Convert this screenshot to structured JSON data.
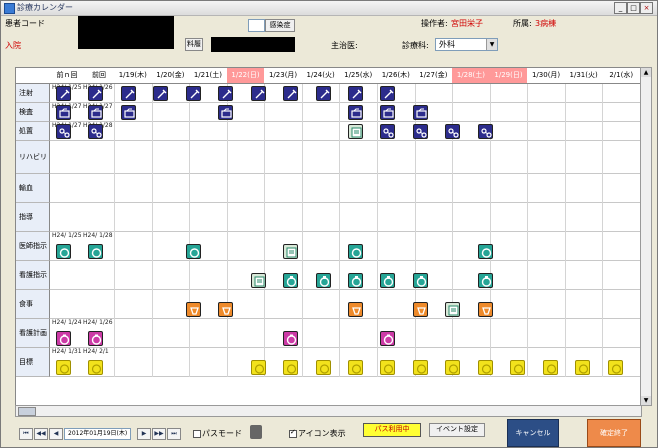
{
  "window": {
    "title": "診療カレンダー",
    "controls": [
      "_",
      "□",
      "×"
    ]
  },
  "header": {
    "patient_code_label": "患者コード",
    "inpatient_label": "入院",
    "small_button": "料履",
    "infection_button": "感染症",
    "operator_label": "操作者:",
    "operator_name": "宮田栄子",
    "affiliation_label": "所属:",
    "affiliation_value": "3病棟",
    "attending_label": "主治医:",
    "department_label": "診療科:",
    "department_value": "外科"
  },
  "calendar": {
    "nav": {
      "prev_n": "前ｎ回",
      "prev": "前回"
    },
    "days": [
      {
        "label": "1/19(木)",
        "holiday": false
      },
      {
        "label": "1/20(金)",
        "holiday": false
      },
      {
        "label": "1/21(土)",
        "holiday": false
      },
      {
        "label": "1/22(日)",
        "holiday": true
      },
      {
        "label": "1/23(月)",
        "holiday": false
      },
      {
        "label": "1/24(火)",
        "holiday": false
      },
      {
        "label": "1/25(水)",
        "holiday": false
      },
      {
        "label": "1/26(木)",
        "holiday": false
      },
      {
        "label": "1/27(金)",
        "holiday": false
      },
      {
        "label": "1/28(土)",
        "holiday": true
      },
      {
        "label": "1/29(日)",
        "holiday": true
      },
      {
        "label": "1/30(月)",
        "holiday": false
      },
      {
        "label": "1/31(火)",
        "holiday": false
      },
      {
        "label": "2/1(水)",
        "holiday": false
      }
    ],
    "rows": [
      {
        "label": "注射"
      },
      {
        "label": "検査"
      },
      {
        "label": "処置"
      },
      {
        "label": "リハビリ"
      },
      {
        "label": "輸血"
      },
      {
        "label": "指導"
      },
      {
        "label": "医師指示"
      },
      {
        "label": "看護指示"
      },
      {
        "label": "食事"
      },
      {
        "label": "看護計画"
      },
      {
        "label": "目標"
      }
    ],
    "notes": [
      {
        "row": 0,
        "text": "H24/ 1/25"
      },
      {
        "row": 0,
        "text": "H24/ 1/26"
      },
      {
        "row": 1,
        "text": "H24/ 1/27"
      },
      {
        "row": 1,
        "text": "H24/ 1/27"
      },
      {
        "row": 2,
        "text": "H24/ 1/27"
      },
      {
        "row": 2,
        "text": "H24/ 1/28"
      },
      {
        "row": 6,
        "text": "H24/ 1/25"
      },
      {
        "row": 6,
        "text": "H24/ 1/28"
      },
      {
        "row": 9,
        "text": "H24/ 1/24"
      },
      {
        "row": 9,
        "text": "H24/ 1/26"
      },
      {
        "row": 10,
        "text": "H24/ 1/31"
      },
      {
        "row": 10,
        "text": "H24/ 2/1"
      }
    ],
    "icons": [
      {
        "row": 0,
        "col": 0,
        "type": "injection"
      },
      {
        "row": 0,
        "col": 1,
        "type": "injection"
      },
      {
        "row": 0,
        "col": 2,
        "type": "injection"
      },
      {
        "row": 0,
        "col": 3,
        "type": "injection"
      },
      {
        "row": 0,
        "col": 4,
        "type": "injection"
      },
      {
        "row": 0,
        "col": 5,
        "type": "injection"
      },
      {
        "row": 0,
        "col": 6,
        "type": "injection"
      },
      {
        "row": 0,
        "col": 7,
        "type": "injection"
      },
      {
        "row": 0,
        "col": 8,
        "type": "injection"
      },
      {
        "row": 0,
        "col": 9,
        "type": "injection"
      },
      {
        "row": 0,
        "col": 10,
        "type": "injection"
      },
      {
        "row": 1,
        "col": 0,
        "type": "exam"
      },
      {
        "row": 1,
        "col": 1,
        "type": "exam"
      },
      {
        "row": 1,
        "col": 2,
        "type": "exam"
      },
      {
        "row": 1,
        "col": 5,
        "type": "exam"
      },
      {
        "row": 1,
        "col": 9,
        "type": "exam"
      },
      {
        "row": 1,
        "col": 10,
        "type": "exam"
      },
      {
        "row": 1,
        "col": 11,
        "type": "exam"
      },
      {
        "row": 2,
        "col": 0,
        "type": "procedure"
      },
      {
        "row": 2,
        "col": 1,
        "type": "procedure"
      },
      {
        "row": 2,
        "col": 9,
        "type": "memo"
      },
      {
        "row": 2,
        "col": 10,
        "type": "procedure"
      },
      {
        "row": 2,
        "col": 11,
        "type": "procedure"
      },
      {
        "row": 2,
        "col": 12,
        "type": "procedure"
      },
      {
        "row": 2,
        "col": 13,
        "type": "procedure"
      },
      {
        "row": 6,
        "col": 0,
        "type": "order"
      },
      {
        "row": 6,
        "col": 1,
        "type": "order"
      },
      {
        "row": 6,
        "col": 4,
        "type": "order"
      },
      {
        "row": 6,
        "col": 7,
        "type": "memo"
      },
      {
        "row": 6,
        "col": 9,
        "type": "order"
      },
      {
        "row": 6,
        "col": 13,
        "type": "order"
      },
      {
        "row": 7,
        "col": 6,
        "type": "memo"
      },
      {
        "row": 7,
        "col": 7,
        "type": "nursing"
      },
      {
        "row": 7,
        "col": 8,
        "type": "nursing"
      },
      {
        "row": 7,
        "col": 9,
        "type": "nursing"
      },
      {
        "row": 7,
        "col": 10,
        "type": "nursing"
      },
      {
        "row": 7,
        "col": 11,
        "type": "nursing"
      },
      {
        "row": 7,
        "col": 13,
        "type": "nursing"
      },
      {
        "row": 8,
        "col": 4,
        "type": "meal"
      },
      {
        "row": 8,
        "col": 5,
        "type": "meal"
      },
      {
        "row": 8,
        "col": 9,
        "type": "meal"
      },
      {
        "row": 8,
        "col": 11,
        "type": "meal"
      },
      {
        "row": 8,
        "col": 12,
        "type": "memo"
      },
      {
        "row": 8,
        "col": 13,
        "type": "meal"
      },
      {
        "row": 9,
        "col": 0,
        "type": "plan"
      },
      {
        "row": 9,
        "col": 1,
        "type": "plan"
      },
      {
        "row": 9,
        "col": 7,
        "type": "plan"
      },
      {
        "row": 9,
        "col": 10,
        "type": "plan"
      },
      {
        "row": 10,
        "col": 0,
        "type": "goal"
      },
      {
        "row": 10,
        "col": 1,
        "type": "goal"
      },
      {
        "row": 10,
        "col": 6,
        "type": "goal"
      },
      {
        "row": 10,
        "col": 7,
        "type": "goal"
      },
      {
        "row": 10,
        "col": 8,
        "type": "goal"
      },
      {
        "row": 10,
        "col": 9,
        "type": "goal"
      },
      {
        "row": 10,
        "col": 10,
        "type": "goal"
      },
      {
        "row": 10,
        "col": 11,
        "type": "goal"
      },
      {
        "row": 10,
        "col": 12,
        "type": "goal"
      },
      {
        "row": 10,
        "col": 13,
        "type": "goal"
      },
      {
        "row": 10,
        "col": 14,
        "type": "goal"
      },
      {
        "row": 10,
        "col": 15,
        "type": "goal"
      },
      {
        "row": 10,
        "col": 16,
        "type": "goal"
      },
      {
        "row": 10,
        "col": 17,
        "type": "goal"
      }
    ]
  },
  "icon_colors": {
    "injection": "#2c2c8c",
    "exam": "#2c2c8c",
    "procedure": "#2c2c8c",
    "order": "#26a596",
    "nursing": "#26a596",
    "meal": "#ee8a2a",
    "plan": "#cc3aa6",
    "goal": "#f2e21c",
    "memo": "#d8e8d8"
  },
  "footer": {
    "date": "2012年01月19日(木)",
    "pass_mode_label": "パスモード",
    "icon_display_label": "アイコン表示",
    "path_in_use_button": "パス利用中",
    "event_setting_button": "イベント設定",
    "cancel_button": "キャンセル",
    "confirm_button": "確定終了",
    "nav": {
      "first": "⏮",
      "prev2": "◀◀",
      "prev": "◀",
      "next": "▶",
      "next2": "▶▶",
      "last": "⏭"
    }
  }
}
